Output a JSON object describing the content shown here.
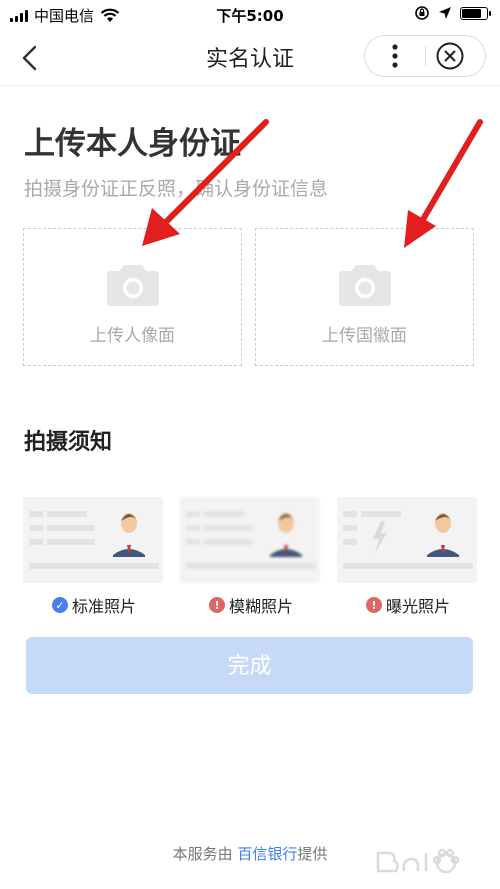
{
  "status_bar": {
    "carrier": "中国电信",
    "time": "下午5:00"
  },
  "nav": {
    "title": "实名认证"
  },
  "main": {
    "title": "上传本人身份证",
    "subtitle": "拍摄身份证正反照，确认身份证信息",
    "upload": [
      {
        "label": "上传人像面"
      },
      {
        "label": "上传国徽面"
      }
    ],
    "tips_title": "拍摄须知",
    "examples": [
      {
        "label": "标准照片",
        "status": "ok"
      },
      {
        "label": "模糊照片",
        "status": "warn"
      },
      {
        "label": "曝光照片",
        "status": "warn"
      }
    ],
    "submit_label": "完成"
  },
  "footer": {
    "prefix": "本服务由 ",
    "provider": "百信银行",
    "suffix": "提供"
  },
  "colors": {
    "accent": "#3d7ff0",
    "button_disabled": "#c6d9f7",
    "ok_badge": "#4a7ee8",
    "warn_badge": "#e06666",
    "annotation_arrow": "#e21e1e"
  },
  "icons": [
    "signal-icon",
    "wifi-icon",
    "rotation-lock-icon",
    "location-icon",
    "battery-icon",
    "back-icon",
    "more-icon",
    "close-icon",
    "camera-icon",
    "check-icon",
    "warning-icon"
  ]
}
